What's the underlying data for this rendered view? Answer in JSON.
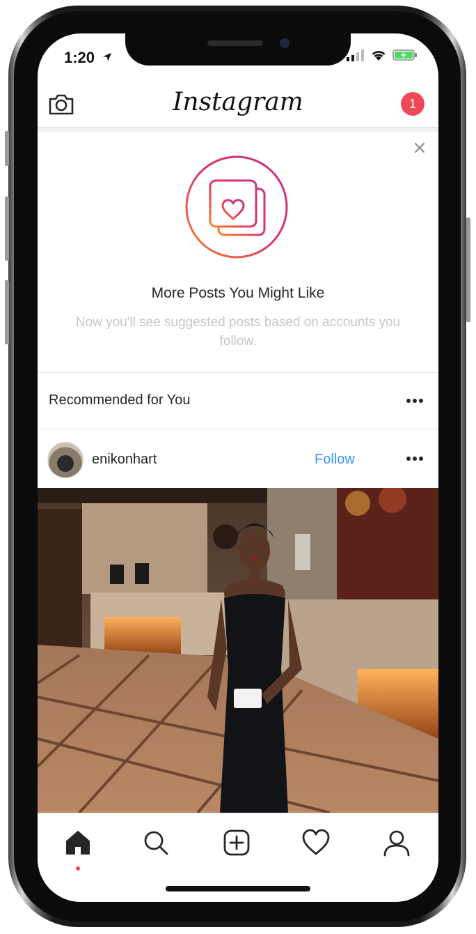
{
  "status_bar": {
    "time": "1:20"
  },
  "header": {
    "logo": "Instagram",
    "notification_count": "1"
  },
  "suggestion": {
    "title": "More Posts You Might Like",
    "subtitle": "Now you'll see suggested posts based on accounts you follow."
  },
  "recommended": {
    "title": "Recommended for You"
  },
  "post": {
    "username": "enikonhart",
    "follow_label": "Follow"
  },
  "tabs": [
    "home-icon",
    "search-icon",
    "add-post-icon",
    "activity-heart-icon",
    "profile-icon"
  ],
  "colors": {
    "badge": "#ed4956",
    "link": "#3897f0",
    "gradient_start": "#f58529",
    "gradient_end": "#dd2a7b"
  }
}
